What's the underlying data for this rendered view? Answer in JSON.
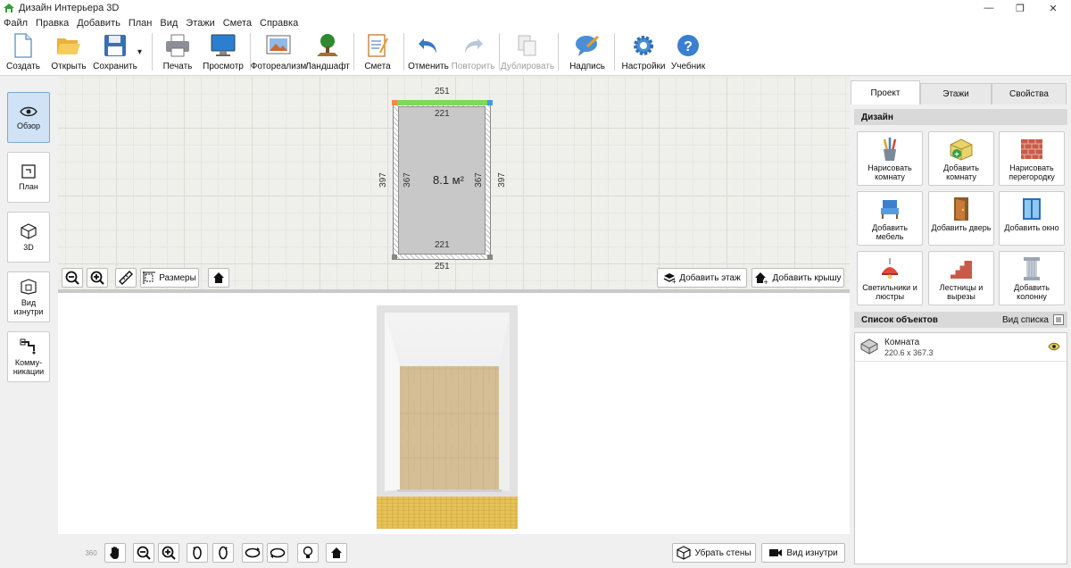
{
  "window": {
    "title": "Дизайн Интерьера 3D",
    "controls": {
      "minimize": "—",
      "maximize": "❐",
      "close": "✕"
    }
  },
  "menu": [
    "Файл",
    "Правка",
    "Добавить",
    "План",
    "Вид",
    "Этажи",
    "Смета",
    "Справка"
  ],
  "toolbar": {
    "create": "Создать",
    "open": "Открыть",
    "save": "Сохранить",
    "save_arrow": "▾",
    "print": "Печать",
    "preview": "Просмотр",
    "photorealism": "Фотореализм",
    "landscape": "Ландшафт",
    "estimate": "Смета",
    "undo": "Отменить",
    "redo": "Повторить",
    "duplicate": "Дублировать",
    "label": "Надпись",
    "settings": "Настройки",
    "tutorial": "Учебник"
  },
  "left_panel": {
    "overview": "Обзор",
    "plan": "План",
    "view3d": "3D",
    "inside_view": "Вид изнутри",
    "utilities": "Комму-никации"
  },
  "plan": {
    "dim_top_outer": "251",
    "dim_top_inner": "221",
    "dim_bottom_inner": "221",
    "dim_bottom_outer": "251",
    "dim_left_outer": "397",
    "dim_left_inner": "367",
    "dim_right_inner": "367",
    "dim_right_outer": "397",
    "area": "8.1 м²",
    "buttons": {
      "dimensions": "Размеры",
      "add_floor": "Добавить этаж",
      "add_roof": "Добавить крышу"
    }
  },
  "view3d": {
    "rotate_360": "360",
    "remove_walls": "Убрать стены",
    "inside_view": "Вид изнутри"
  },
  "right_panel": {
    "tabs": [
      "Проект",
      "Этажи",
      "Свойства"
    ],
    "design_header": "Дизайн",
    "design_buttons": [
      "Нарисовать комнату",
      "Добавить комнату",
      "Нарисовать перегородку",
      "Добавить мебель",
      "Добавить дверь",
      "Добавить окно",
      "Светильники и люстры",
      "Лестницы и вырезы",
      "Добавить колонну"
    ],
    "objects_header": "Список объектов",
    "list_view": "Вид списка",
    "objects": [
      {
        "name": "Комната",
        "size": "220.6 x 367.3"
      }
    ]
  },
  "colors": {
    "active_left": "#cfe2f6",
    "top_wall": "#7ed957",
    "floor_wood": "#d7bf95"
  }
}
